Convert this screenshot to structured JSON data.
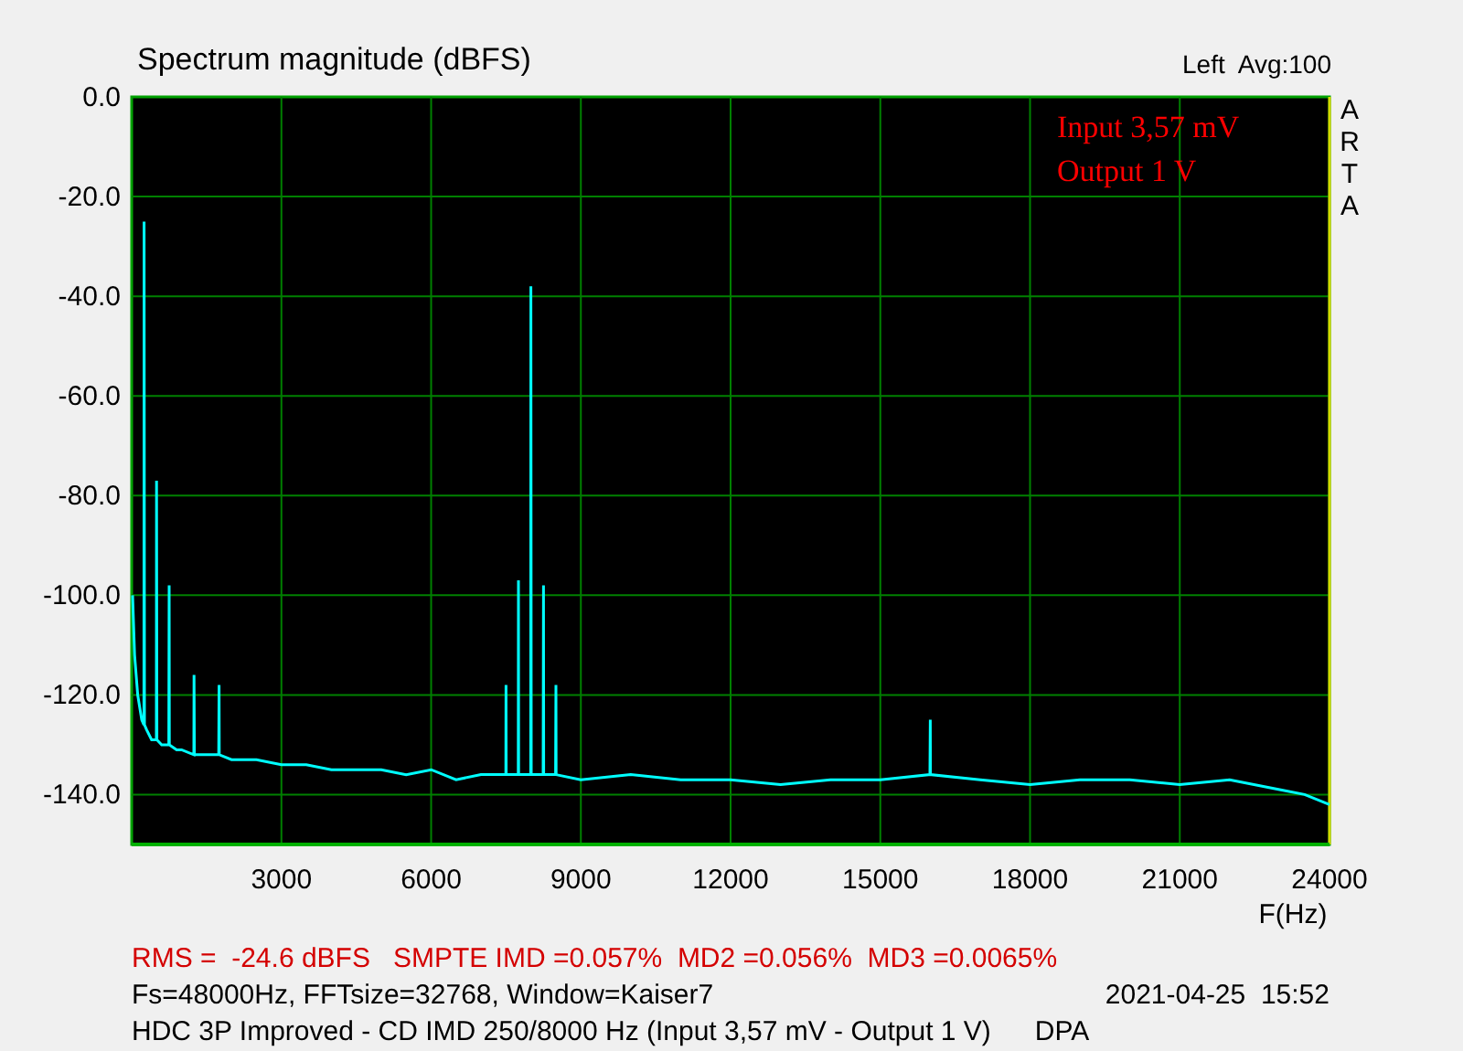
{
  "header": {
    "title": "Spectrum magnitude (dBFS)",
    "channel_info": "Left  Avg:100"
  },
  "plot": {
    "side_letters": [
      "A",
      "R",
      "T",
      "A"
    ],
    "chart_data": {
      "type": "line",
      "grid": true,
      "xlabel": "F(Hz)",
      "xlim": [
        0,
        24000
      ],
      "ylim": [
        -150,
        0
      ],
      "xticks": [
        3000,
        6000,
        9000,
        12000,
        15000,
        18000,
        21000,
        24000
      ],
      "yticks": [
        {
          "value": 0,
          "label": "0.0"
        },
        {
          "value": -20,
          "label": "-20.0"
        },
        {
          "value": -40,
          "label": "-40.0"
        },
        {
          "value": -60,
          "label": "-60.0"
        },
        {
          "value": -80,
          "label": "-80.0"
        },
        {
          "value": -100,
          "label": "-100.0"
        },
        {
          "value": -120,
          "label": "-120.0"
        },
        {
          "value": -140,
          "label": "-140.0"
        }
      ],
      "x": [
        20,
        60,
        120,
        200,
        245,
        250,
        255,
        300,
        400,
        495,
        500,
        505,
        600,
        745,
        750,
        755,
        900,
        1000,
        1245,
        1250,
        1255,
        1500,
        1745,
        1750,
        1755,
        2000,
        2500,
        3000,
        3500,
        4000,
        4500,
        5000,
        5500,
        6000,
        6500,
        7000,
        7495,
        7500,
        7505,
        7745,
        7750,
        7755,
        7995,
        8000,
        8005,
        8245,
        8250,
        8255,
        8495,
        8500,
        8505,
        9000,
        10000,
        11000,
        12000,
        13000,
        14000,
        15000,
        15995,
        16000,
        16005,
        17000,
        18000,
        19000,
        20000,
        21000,
        22000,
        23000,
        23500,
        24000
      ],
      "series": [
        {
          "color": "#00ffff",
          "values": [
            -100,
            -112,
            -120,
            -125,
            -126,
            -25,
            -126,
            -127,
            -129,
            -129,
            -77,
            -129,
            -130,
            -130,
            -98,
            -130,
            -131,
            -131,
            -132,
            -116,
            -132,
            -132,
            -132,
            -118,
            -132,
            -133,
            -133,
            -134,
            -134,
            -135,
            -135,
            -135,
            -136,
            -135,
            -137,
            -136,
            -136,
            -118,
            -136,
            -136,
            -97,
            -136,
            -136,
            -38,
            -136,
            -136,
            -98,
            -136,
            -136,
            -118,
            -136,
            -137,
            -136,
            -137,
            -137,
            -138,
            -137,
            -137,
            -136,
            -125,
            -136,
            -137,
            -138,
            -137,
            -137,
            -138,
            -137,
            -139,
            -140,
            -142
          ]
        }
      ],
      "annotations": [
        "Input 3,57 mV",
        "Output 1 V"
      ]
    }
  },
  "footer": {
    "measurement": "RMS =  -24.6 dBFS   SMPTE IMD =0.057%  MD2 =0.056%  MD3 =0.0065%",
    "settings": "Fs=48000Hz, FFTsize=32768, Window=Kaiser7",
    "timestamp": "2021-04-25  15:52",
    "description": "HDC 3P Improved - CD IMD 250/8000 Hz (Input 3,57 mV - Output 1 V)",
    "tag": "DPA"
  }
}
